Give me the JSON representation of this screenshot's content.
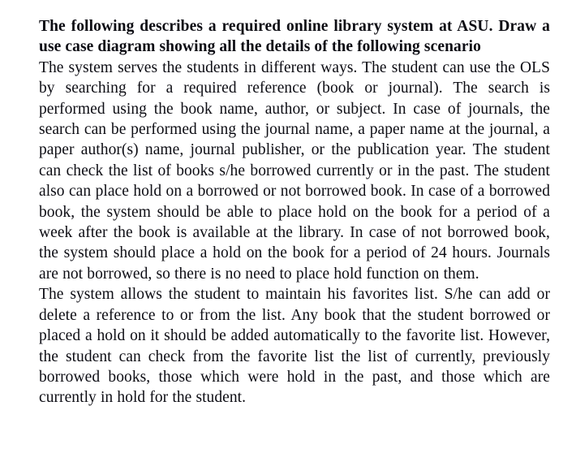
{
  "document": {
    "background_color": "#ffffff",
    "text_color": "#0d0d14",
    "heading": "The following describes a required online library system at ASU. Draw a use case diagram showing all the details of the following scenario",
    "paragraphs": [
      "The system serves the students in different ways.  The student can use the OLS by searching for a required reference (book or journal).  The search is performed using the book name, author, or subject.  In case of journals, the search can be performed using the journal name, a paper name at the journal, a paper author(s) name, journal publisher, or the publication year.  The student can check the list of books s/he borrowed currently or in the past.  The student also can place hold on a borrowed or not borrowed book.  In case of a borrowed book, the system should be able to place hold on the book for a period of a week after the book is available at the library.  In case of not borrowed book, the system should place a hold on the book for a period of 24 hours.  Journals are not borrowed, so there is no need to place hold function on them.",
      "The system allows the student to maintain his favorites list.  S/he can add or delete a reference to or from the list.  Any book that the student borrowed or placed a hold on it should be added automatically to the favorite list.  However, the student can check from the favorite list the list of currently, previously borrowed books, those which were hold in the past, and those which are currently in hold for the student."
    ]
  }
}
